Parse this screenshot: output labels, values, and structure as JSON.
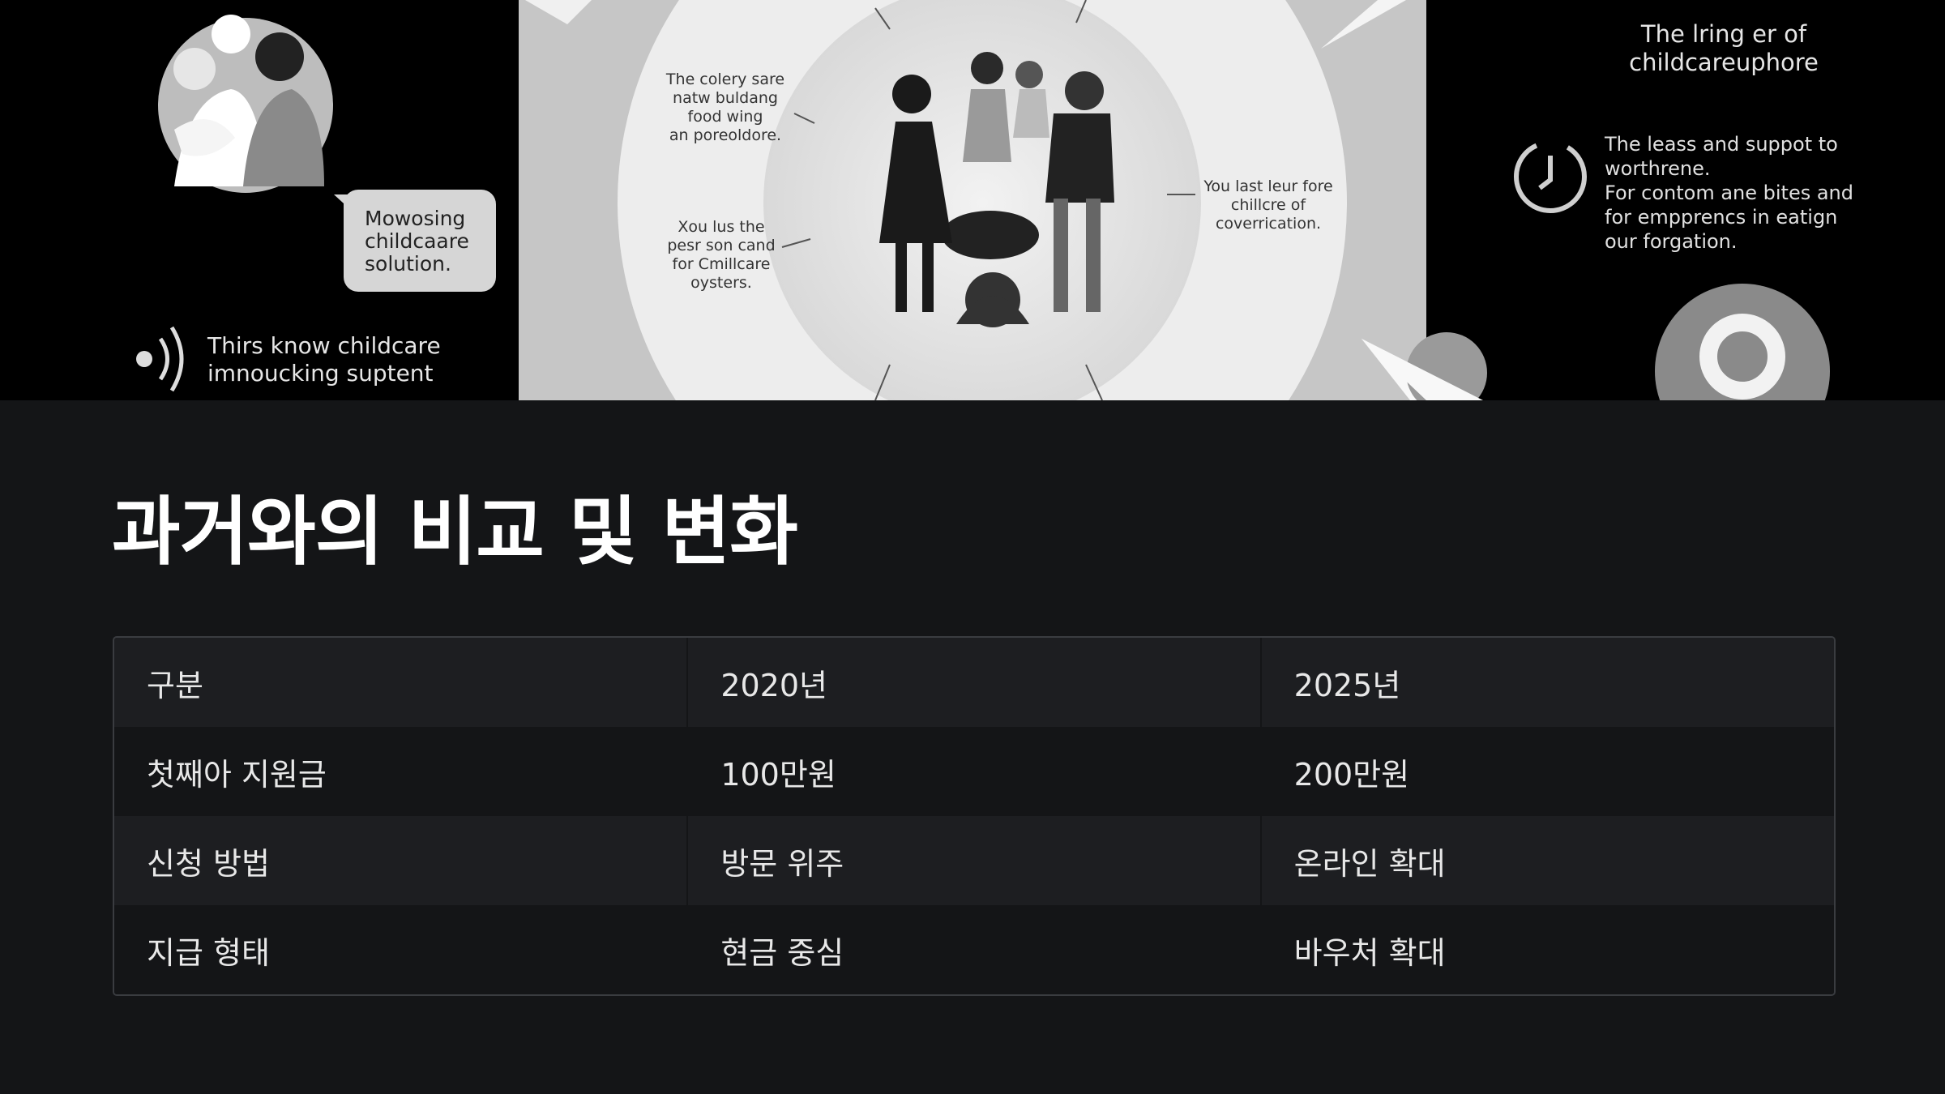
{
  "hero": {
    "left_bubble": "Mowosing\nchildcaare\nsolution.",
    "left_caption_line1": "Thirs know childcare",
    "left_caption_line2": "imnoucking suptent",
    "center_note_top_left": [
      "The colery sare",
      "natw buldang",
      "food wing",
      "an poreoldore."
    ],
    "center_note_bottom_left": [
      "Xou lus the",
      "pesr son cand",
      "for Cmillcare",
      "oysters."
    ],
    "center_note_right": [
      "You last leur fore",
      "chillcre of",
      "coverrication."
    ],
    "right_title_line1": "The lring er of",
    "right_title_line2": "childcareuphore",
    "right_body": [
      "The leass and suppot to",
      "worthrene.",
      "For contom ane bites and",
      "for empprencs in eatign",
      "our forgation."
    ]
  },
  "section": {
    "title": "과거와의 비교 및 변화"
  },
  "table": {
    "headers": [
      "구분",
      "2020년",
      "2025년"
    ],
    "rows": [
      [
        "첫째아 지원금",
        "100만원",
        "200만원"
      ],
      [
        "신청 방법",
        "방문 위주",
        "온라인 확대"
      ],
      [
        "지급 형태",
        "현금 중심",
        "바우처 확대"
      ]
    ]
  }
}
